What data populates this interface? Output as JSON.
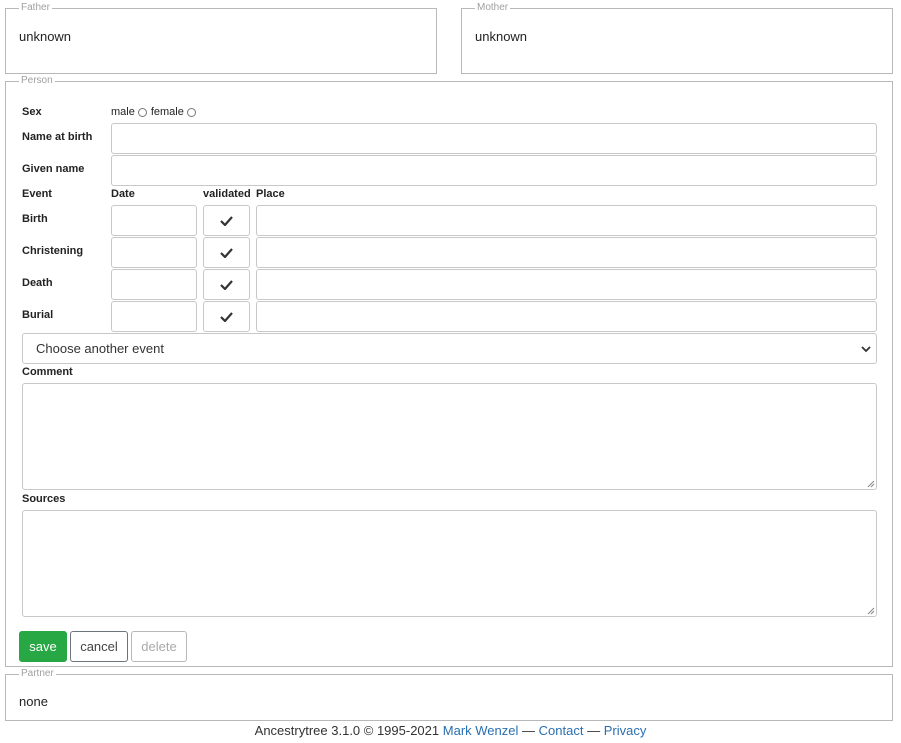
{
  "father": {
    "legend": "Father",
    "value": "unknown"
  },
  "mother": {
    "legend": "Mother",
    "value": "unknown"
  },
  "person": {
    "legend": "Person",
    "sex": {
      "label": "Sex",
      "male": "male",
      "female": "female"
    },
    "name_at_birth_label": "Name at birth",
    "given_name_label": "Given name",
    "events_header": {
      "event": "Event",
      "date": "Date",
      "validated": "validated",
      "place": "Place"
    },
    "events": [
      {
        "label": "Birth"
      },
      {
        "label": "Christening"
      },
      {
        "label": "Death"
      },
      {
        "label": "Burial"
      }
    ],
    "choose_event": "Choose another event",
    "comment_label": "Comment",
    "sources_label": "Sources",
    "buttons": {
      "save": "save",
      "cancel": "cancel",
      "delete": "delete"
    }
  },
  "partner": {
    "legend": "Partner",
    "value": "none"
  },
  "footer": {
    "text": "Ancestrytree 3.1.0 © 1995-2021",
    "author": "Mark Wenzel",
    "sep1": "—",
    "contact": "Contact",
    "sep2": "—",
    "privacy": "Privacy"
  },
  "colors": {
    "save": "#28a745",
    "link": "#2a6fb0"
  },
  "icons": {
    "validated": "check-icon",
    "select": "chevron-down-icon",
    "resize": "resize-grip-icon"
  }
}
